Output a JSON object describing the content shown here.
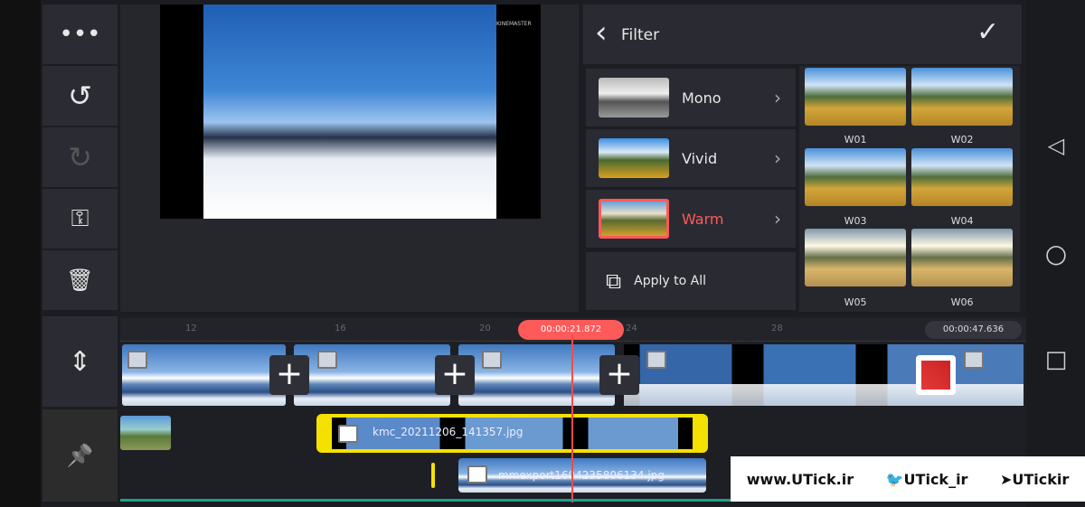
{
  "toolbar": {
    "more": "•••",
    "undo": "↺",
    "redo": "↻",
    "key": "⚿",
    "trash": "🗑",
    "expand": "⇕",
    "pin": "📌"
  },
  "preview": {
    "watermark": "KINEMASTER"
  },
  "filter": {
    "title": "Filter",
    "back": "‹",
    "confirm": "✓",
    "categories": [
      {
        "label": "Mono"
      },
      {
        "label": "Vivid"
      },
      {
        "label": "Warm",
        "selected": true
      }
    ],
    "apply_all": "Apply to All",
    "tiles": [
      "W01",
      "W02",
      "W03",
      "W04",
      "W05",
      "W06"
    ],
    "accent": "#ff5a5a"
  },
  "timeline": {
    "ticks": [
      "12",
      "16",
      "20",
      "24",
      "28"
    ],
    "playhead_time": "00:00:21.872",
    "total_time": "00:00:47.636",
    "layer1_name": "kmc_20211206_141357.jpg",
    "layer2_name": "mmexport1604235806134.jpg",
    "selected_color": "#f5e100",
    "playhead_color": "#ff4a4a"
  },
  "watermark": {
    "site": "www.UTick.ir",
    "twitter": "UTick_ir",
    "telegram": "UTickir"
  }
}
